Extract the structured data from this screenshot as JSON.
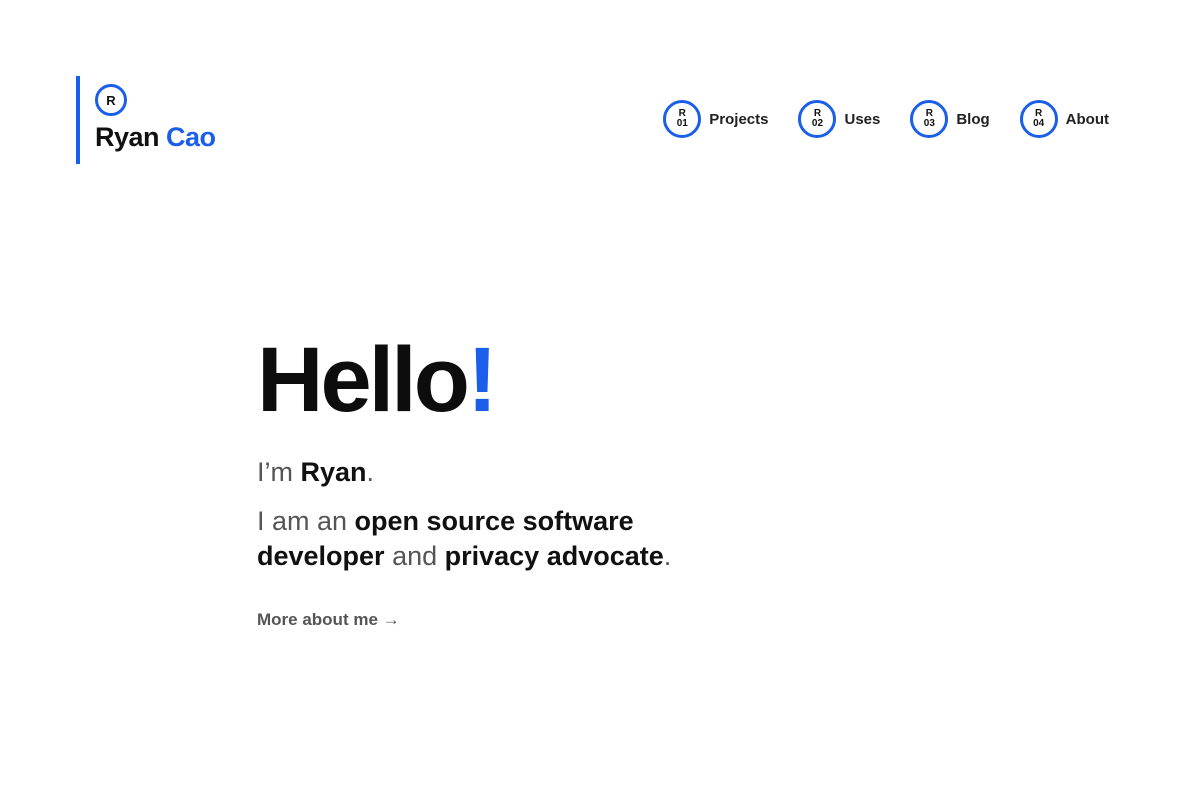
{
  "brand": {
    "badge_letter": "R",
    "first_name": "Ryan",
    "last_name": "Cao",
    "accent_color": "#1a5eea"
  },
  "nav": {
    "items": [
      {
        "badge_letter": "R",
        "badge_number": "01",
        "label": "Projects"
      },
      {
        "badge_letter": "R",
        "badge_number": "02",
        "label": "Uses"
      },
      {
        "badge_letter": "R",
        "badge_number": "03",
        "label": "Blog"
      },
      {
        "badge_letter": "R",
        "badge_number": "04",
        "label": "About"
      }
    ]
  },
  "hero": {
    "greeting": "Hello",
    "greeting_punct": "!",
    "intro_prefix": "I’m ",
    "intro_name": "Ryan",
    "intro_suffix": ".",
    "tagline_prefix": "I am an ",
    "tagline_role1": "open source software developer",
    "tagline_mid": " and ",
    "tagline_role2": "privacy advocate",
    "tagline_suffix": ".",
    "more_link": "More about me →"
  }
}
